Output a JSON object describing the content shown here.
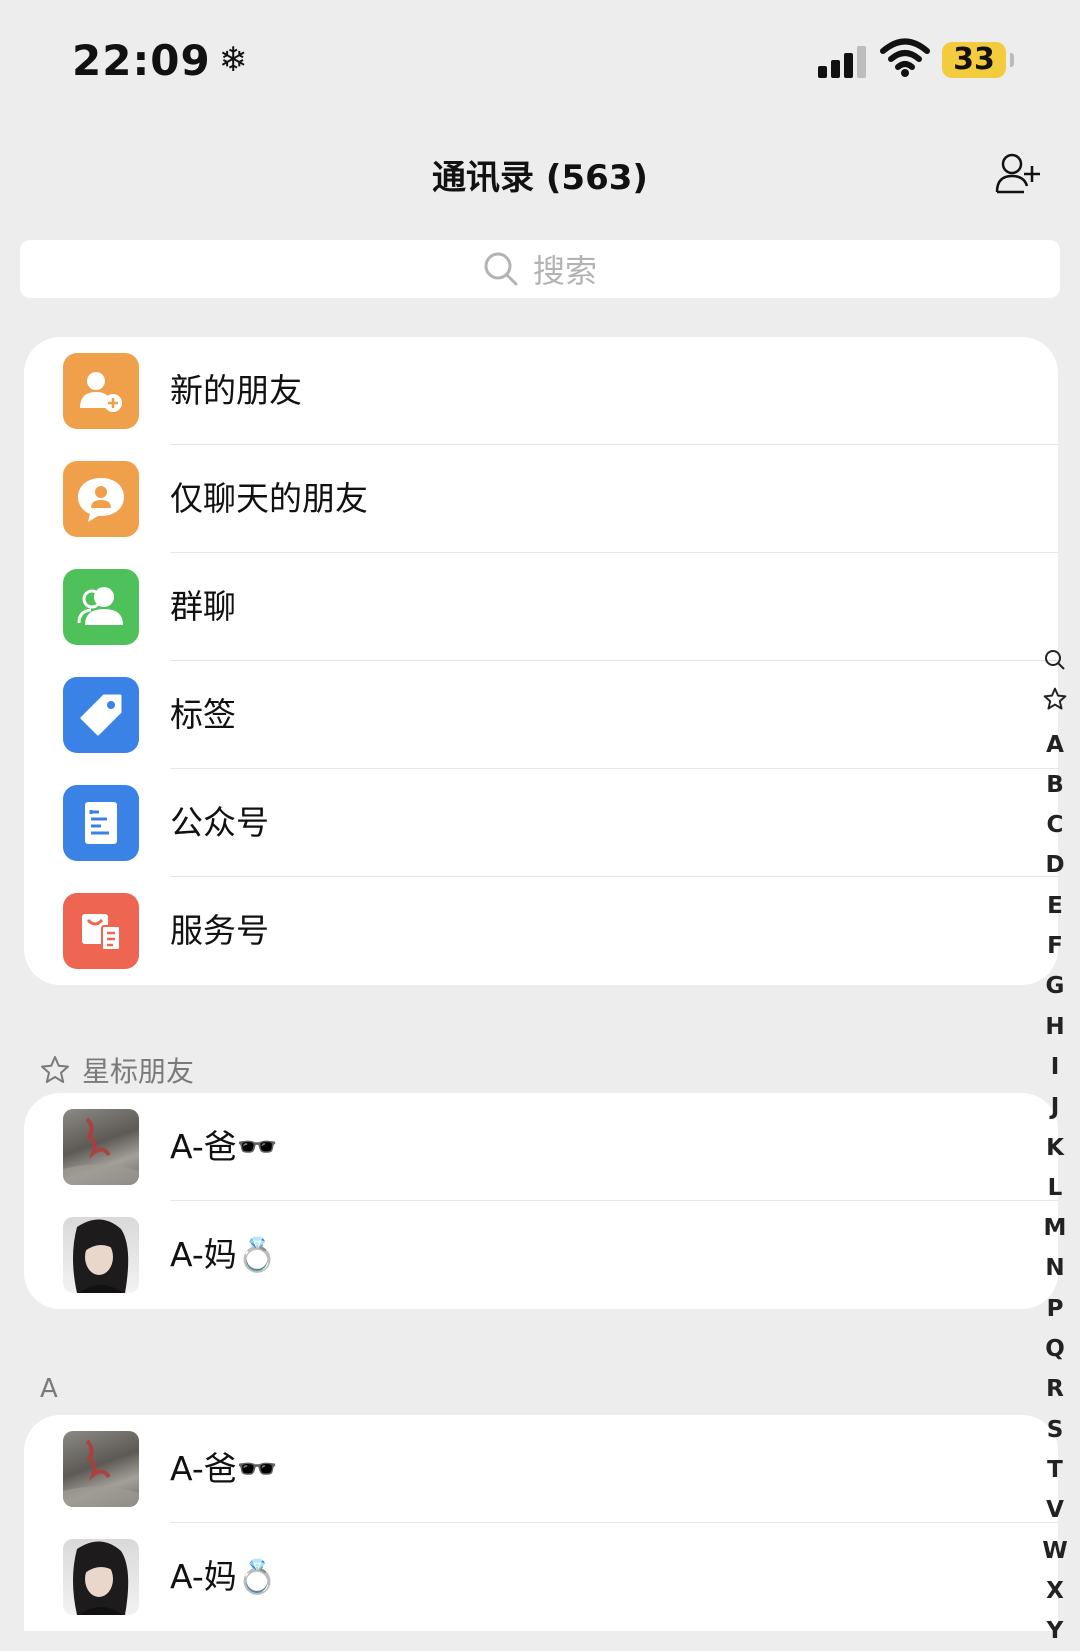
{
  "status_bar": {
    "time": "22:09",
    "time_symbol": "❄",
    "battery": "33",
    "battery_color": "#f2cc3d"
  },
  "header": {
    "title": "通讯录 (563)",
    "add_icon": "add-contact-icon"
  },
  "search": {
    "placeholder": "搜索"
  },
  "menu": [
    {
      "label": "新的朋友",
      "icon": "new-friend-icon",
      "color": "#f0a04b"
    },
    {
      "label": "仅聊天的朋友",
      "icon": "chat-only-icon",
      "color": "#f0a04b"
    },
    {
      "label": "群聊",
      "icon": "group-chat-icon",
      "color": "#4fc15a"
    },
    {
      "label": "标签",
      "icon": "tag-icon",
      "color": "#3b82e6"
    },
    {
      "label": "公众号",
      "icon": "official-account-icon",
      "color": "#3b82e6"
    },
    {
      "label": "服务号",
      "icon": "service-account-icon",
      "color": "#ee6652"
    }
  ],
  "starred": {
    "header": "星标朋友",
    "contacts": [
      {
        "name": "A-爸🕶️"
      },
      {
        "name": "A-妈💍"
      }
    ]
  },
  "section_a": {
    "header": "A",
    "contacts": [
      {
        "name": "A-爸🕶️"
      },
      {
        "name": "A-妈💍"
      }
    ]
  },
  "index_bar": [
    "🔍",
    "☆",
    "A",
    "B",
    "C",
    "D",
    "E",
    "F",
    "G",
    "H",
    "I",
    "J",
    "K",
    "L",
    "M",
    "N",
    "P",
    "Q",
    "R",
    "S",
    "T",
    "V",
    "W",
    "X",
    "Y"
  ]
}
